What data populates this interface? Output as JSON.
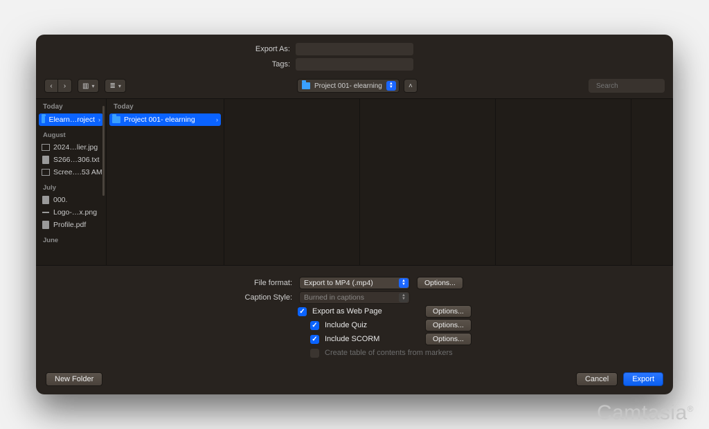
{
  "header": {
    "exportAsLabel": "Export As:",
    "exportAsValue": "",
    "tagsLabel": "Tags:",
    "tagsValue": ""
  },
  "toolbar": {
    "path": "Project 001- elearning",
    "searchPlaceholder": "Search"
  },
  "sidebar": {
    "sections": [
      {
        "label": "Today",
        "items": [
          {
            "icon": "folder",
            "name": "Elearn…roject",
            "selected": true,
            "hasChildren": true
          }
        ]
      },
      {
        "label": "August",
        "items": [
          {
            "icon": "image",
            "name": "2024…lier.jpg"
          },
          {
            "icon": "file",
            "name": "S266…306.txt"
          },
          {
            "icon": "image",
            "name": "Scree….53 AM"
          }
        ]
      },
      {
        "label": "July",
        "items": [
          {
            "icon": "file",
            "name": "000."
          },
          {
            "icon": "dash",
            "name": "Logo-…x.png"
          },
          {
            "icon": "file",
            "name": "Profile.pdf"
          }
        ]
      },
      {
        "label": "June",
        "items": []
      }
    ]
  },
  "column2": {
    "header": "Today",
    "item": {
      "name": "Project 001- elearning",
      "selected": true,
      "hasChildren": true
    }
  },
  "format": {
    "fileFormatLabel": "File format:",
    "fileFormatValue": "Export to MP4 (.mp4)",
    "captionStyleLabel": "Caption Style:",
    "captionStyleValue": "Burned in captions",
    "optionsLabel": "Options...",
    "checks": {
      "webPage": "Export as Web Page",
      "quiz": "Include Quiz",
      "scorm": "Include SCORM",
      "toc": "Create table of contents from markers"
    }
  },
  "footer": {
    "newFolder": "New Folder",
    "cancel": "Cancel",
    "export": "Export"
  },
  "watermark": "Camtasia"
}
